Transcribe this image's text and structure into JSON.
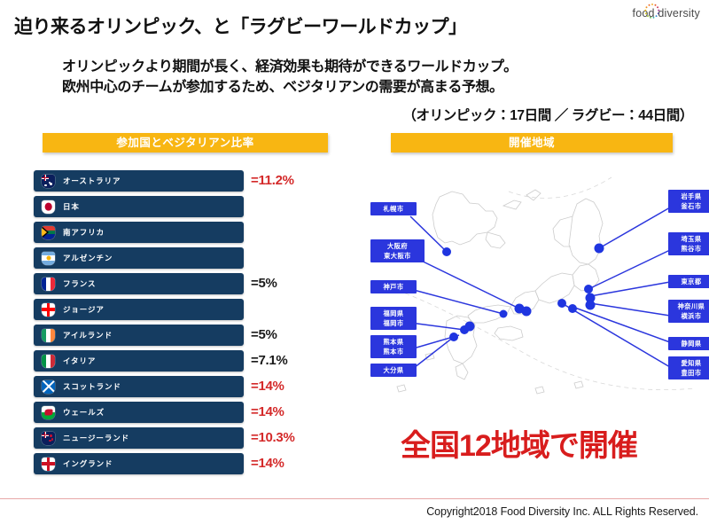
{
  "logo": {
    "text": "food diversity",
    "mark": "dotted-circle-icon"
  },
  "header": {
    "title": "迫り来るオリンピック、と「ラグビーワールドカップ」",
    "subtitle_line1": "オリンピックより期間が長く、経済効果も期待ができるワールドカップ。",
    "subtitle_line2": "欧州中心のチームが参加するため、ベジタリアンの需要が高まる予想。",
    "note": "（オリンピック：17日間 ／ ラグビー：44日間）"
  },
  "sections": {
    "left_banner": "参加国とベジタリアン比率",
    "right_banner": "開催地域"
  },
  "colors": {
    "banner": "#f8b612",
    "row": "#153c61",
    "accent_red": "#d42a2a",
    "headline_red": "#d81d1d",
    "map_blue": "#2b36dd"
  },
  "countries": [
    {
      "name": "オーストラリア",
      "value": "=11.2%",
      "highlight": true,
      "flag": "flag-australia"
    },
    {
      "name": "日本",
      "value": "",
      "highlight": false,
      "flag": "flag-japan"
    },
    {
      "name": "南アフリカ",
      "value": "",
      "highlight": false,
      "flag": "flag-south-africa"
    },
    {
      "name": "アルゼンチン",
      "value": "",
      "highlight": false,
      "flag": "flag-argentina"
    },
    {
      "name": "フランス",
      "value": "=5%",
      "highlight": false,
      "flag": "flag-france"
    },
    {
      "name": "ジョージア",
      "value": "",
      "highlight": false,
      "flag": "flag-georgia"
    },
    {
      "name": "アイルランド",
      "value": "=5%",
      "highlight": false,
      "flag": "flag-ireland"
    },
    {
      "name": "イタリア",
      "value": "=7.1%",
      "highlight": false,
      "flag": "flag-italy"
    },
    {
      "name": "スコットランド",
      "value": "=14%",
      "highlight": true,
      "flag": "flag-scotland"
    },
    {
      "name": "ウェールズ",
      "value": "=14%",
      "highlight": true,
      "flag": "flag-wales"
    },
    {
      "name": "ニュージーランド",
      "value": "=10.3%",
      "highlight": true,
      "flag": "flag-new-zealand"
    },
    {
      "name": "イングランド",
      "value": "=14%",
      "highlight": true,
      "flag": "flag-england"
    }
  ],
  "map": {
    "labels_left": [
      {
        "line1": "札幌市",
        "line2": ""
      },
      {
        "line1": "大阪府",
        "line2": "東大阪市"
      },
      {
        "line1": "神戸市",
        "line2": ""
      },
      {
        "line1": "福岡県",
        "line2": "福岡市"
      },
      {
        "line1": "熊本県",
        "line2": "熊本市"
      },
      {
        "line1": "大分県",
        "line2": ""
      }
    ],
    "labels_right": [
      {
        "line1": "岩手県",
        "line2": "釜石市"
      },
      {
        "line1": "埼玉県",
        "line2": "熊谷市"
      },
      {
        "line1": "東京都",
        "line2": ""
      },
      {
        "line1": "神奈川県",
        "line2": "横浜市"
      },
      {
        "line1": "静岡県",
        "line2": ""
      },
      {
        "line1": "愛知県",
        "line2": "豊田市"
      }
    ]
  },
  "headline": "全国12地域で開催",
  "footer": "Copyright2018   Food Diversity Inc.  ALL Rights Reserved."
}
